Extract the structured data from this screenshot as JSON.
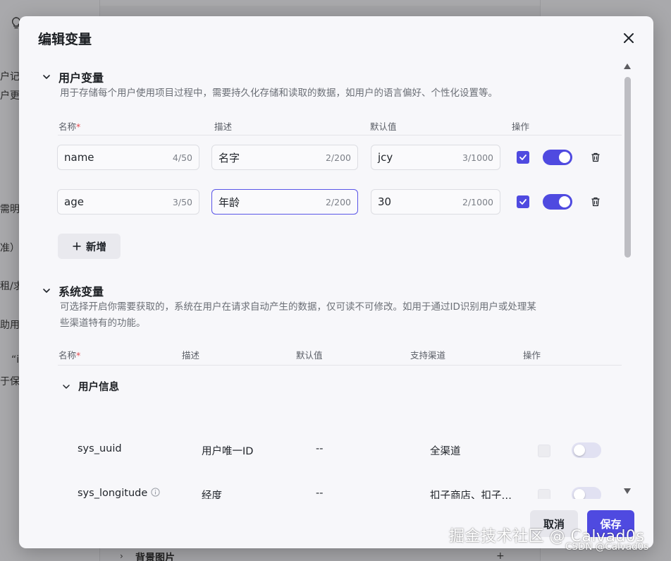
{
  "background": {
    "left_fragments": [
      "户记",
      "户更",
      "需明确",
      "准）",
      "租/求",
      "助用",
      "“i",
      "于保存"
    ],
    "bottom_section_label": "背景图片",
    "bottom_add": "+"
  },
  "modal": {
    "title": "编辑变量",
    "close_icon": "close-icon"
  },
  "user_vars": {
    "title": "用户变量",
    "desc": "用于存储每个用户使用项目过程中，需要持久化存储和读取的数据，如用户的语言偏好、个性化设置等。",
    "headers": {
      "name": "名称",
      "required_mark": "*",
      "desc": "描述",
      "default": "默认值",
      "actions": "操作"
    },
    "rows": [
      {
        "name": "name",
        "name_count": "4/50",
        "desc": "名字",
        "desc_count": "2/200",
        "default": "jcy",
        "default_count": "3/1000",
        "checked": true,
        "enabled": true
      },
      {
        "name": "age",
        "name_count": "3/50",
        "desc": "年龄",
        "desc_count": "2/200",
        "default": "30",
        "default_count": "2/1000",
        "checked": true,
        "enabled": true
      }
    ],
    "add_label": "新增"
  },
  "system_vars": {
    "title": "系统变量",
    "desc_line1": "可选择开启你需要获取的，系统在用户在请求自动产生的数据，仅可读不可修改。如用于通过ID识别用户或处理某",
    "desc_line2": "些渠道特有的功能。",
    "headers": {
      "name": "名称",
      "required_mark": "*",
      "desc": "描述",
      "default": "默认值",
      "channels": "支持渠道",
      "actions": "操作"
    },
    "group_title": "用户信息",
    "rows": [
      {
        "name": "sys_uuid",
        "desc": "用户唯一ID",
        "default": "--",
        "channels": "全渠道",
        "checked": false,
        "enabled": false
      },
      {
        "name": "sys_longitude",
        "desc": "经度",
        "default": "--",
        "channels": "扣子商店、扣子…",
        "checked": false,
        "enabled": false
      }
    ]
  },
  "footer": {
    "cancel": "取消",
    "save": "保存"
  },
  "watermark": {
    "main": "掘金技术社区 @ Calvad0s",
    "sub": "CSDN @Calvad0s"
  },
  "colors": {
    "accent": "#4f4ae0",
    "required": "#e5484d"
  }
}
